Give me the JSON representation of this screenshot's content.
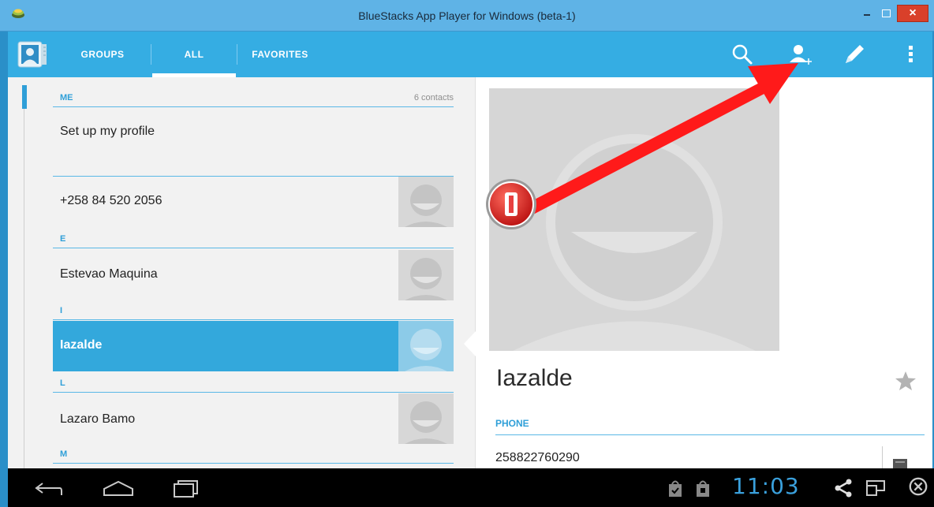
{
  "window": {
    "title": "BlueStacks App Player for Windows (beta-1)"
  },
  "actionbar": {
    "tabs": [
      {
        "label": "GROUPS"
      },
      {
        "label": "ALL",
        "selected": true
      },
      {
        "label": "FAVORITES"
      }
    ],
    "actions": [
      "search-icon",
      "add-contact-icon",
      "edit-icon",
      "overflow-menu-icon"
    ]
  },
  "list": {
    "me_header": "ME",
    "contact_count": "6 contacts",
    "setup_profile": "Set up my profile",
    "contacts": [
      {
        "section": "",
        "name": "+258 84 520 2056"
      },
      {
        "section": "E",
        "name": "Estevao Maquina"
      },
      {
        "section": "I",
        "name": "Iazalde",
        "selected": true
      },
      {
        "section": "L",
        "name": "Lazaro Bamo"
      },
      {
        "section": "M",
        "name": ""
      }
    ]
  },
  "detail": {
    "name": "Iazalde",
    "phone_header": "PHONE",
    "phone_number": "258822760290"
  },
  "navbar": {
    "clock": "11:03"
  },
  "annotation": {
    "marker_color": "#e02020",
    "arrow_color": "#ff1a1a"
  },
  "colors": {
    "accent": "#35ade3",
    "selection": "#33a8dc",
    "clock": "#3aa0dc"
  }
}
